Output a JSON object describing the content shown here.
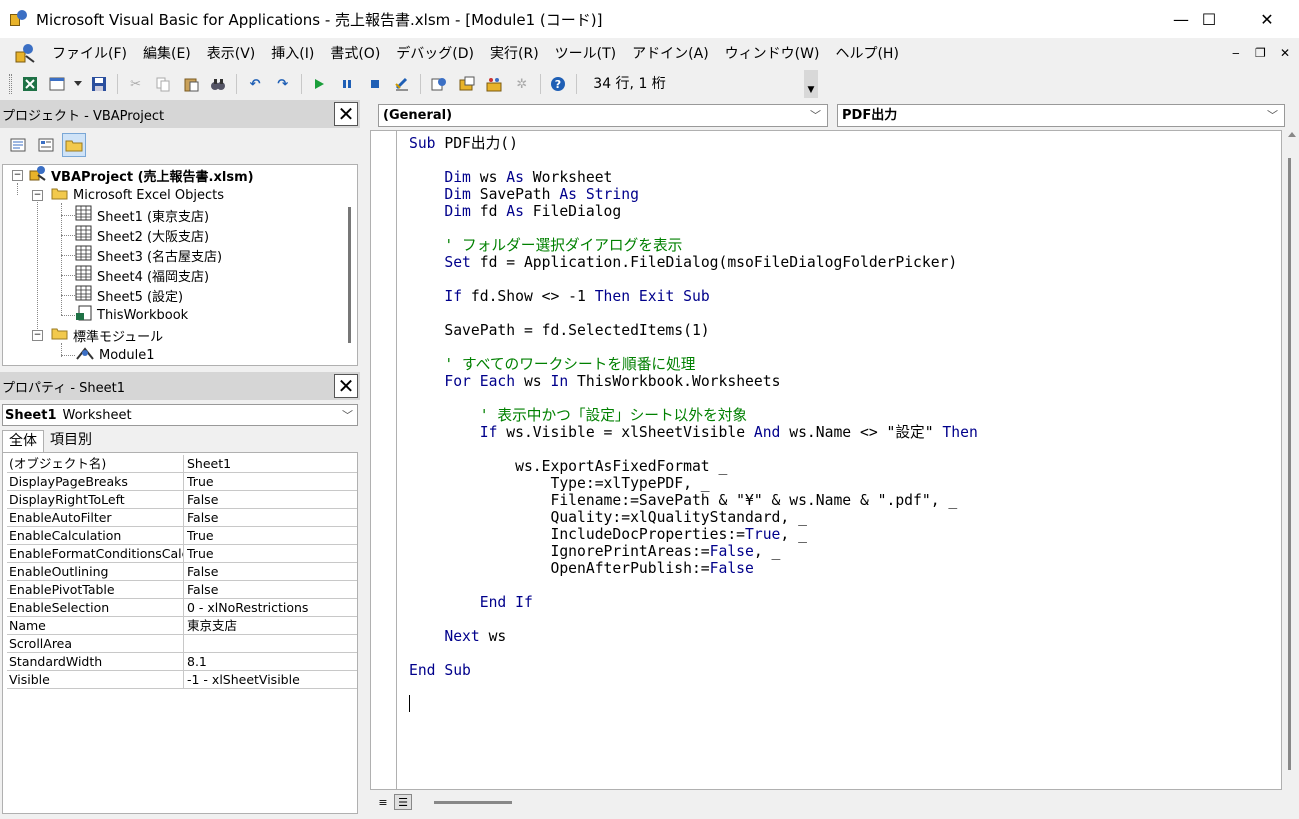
{
  "window": {
    "title": "Microsoft Visual Basic for Applications - 売上報告書.xlsm - [Module1 (コード)]",
    "minimize": "—",
    "maximize": "☐",
    "close": "✕"
  },
  "menu": {
    "items": [
      "ファイル(F)",
      "編集(E)",
      "表示(V)",
      "挿入(I)",
      "書式(O)",
      "デバッグ(D)",
      "実行(R)",
      "ツール(T)",
      "アドイン(A)",
      "ウィンドウ(W)",
      "ヘルプ(H)"
    ],
    "mdi_minimize": "‒",
    "mdi_restore": "❐",
    "mdi_close": "✕"
  },
  "toolbar": {
    "status": "34 行, 1 桁"
  },
  "project": {
    "title": "プロジェクト - VBAProject",
    "close": "✕",
    "tree": {
      "root": "VBAProject (売上報告書.xlsm)",
      "excel_objects": "Microsoft Excel Objects",
      "sheets": [
        "Sheet1 (東京支店)",
        "Sheet2 (大阪支店)",
        "Sheet3 (名古屋支店)",
        "Sheet4 (福岡支店)",
        "Sheet5 (設定)"
      ],
      "workbook": "ThisWorkbook",
      "modules_folder": "標準モジュール",
      "module": "Module1"
    }
  },
  "properties": {
    "title": "プロパティ - Sheet1",
    "close": "✕",
    "object_name": "Sheet1",
    "object_type": "Worksheet",
    "tabs": [
      "全体",
      "項目別"
    ],
    "rows": [
      {
        "k": "(オブジェクト名)",
        "v": "Sheet1"
      },
      {
        "k": "DisplayPageBreaks",
        "v": "True"
      },
      {
        "k": "DisplayRightToLeft",
        "v": "False"
      },
      {
        "k": "EnableAutoFilter",
        "v": "False"
      },
      {
        "k": "EnableCalculation",
        "v": "True"
      },
      {
        "k": "EnableFormatConditionsCalculation",
        "v": "True"
      },
      {
        "k": "EnableOutlining",
        "v": "False"
      },
      {
        "k": "EnablePivotTable",
        "v": "False"
      },
      {
        "k": "EnableSelection",
        "v": "0 - xlNoRestrictions"
      },
      {
        "k": "Name",
        "v": "東京支店"
      },
      {
        "k": "ScrollArea",
        "v": ""
      },
      {
        "k": "StandardWidth",
        "v": "8.1"
      },
      {
        "k": "Visible",
        "v": "-1 - xlSheetVisible"
      }
    ]
  },
  "code": {
    "object_combo": "(General)",
    "proc_combo": "PDF出力",
    "lines": [
      "Sub PDF出力()",
      "",
      "    Dim ws As Worksheet",
      "    Dim SavePath As String",
      "    Dim fd As FileDialog",
      "",
      "    ' フォルダー選択ダイアログを表示",
      "    Set fd = Application.FileDialog(msoFileDialogFolderPicker)",
      "",
      "    If fd.Show <> -1 Then Exit Sub",
      "",
      "    SavePath = fd.SelectedItems(1)",
      "",
      "    ' すべてのワークシートを順番に処理",
      "    For Each ws In ThisWorkbook.Worksheets",
      "",
      "        ' 表示中かつ「設定」シート以外を対象",
      "        If ws.Visible = xlSheetVisible And ws.Name <> \"設定\" Then",
      "",
      "            ws.ExportAsFixedFormat _",
      "                Type:=xlTypePDF, _",
      "                Filename:=SavePath & \"¥\" & ws.Name & \".pdf\", _",
      "                Quality:=xlQualityStandard, _",
      "                IncludeDocProperties:=True, _",
      "                IgnorePrintAreas:=False, _",
      "                OpenAfterPublish:=False",
      "",
      "        End If",
      "",
      "    Next ws",
      "",
      "End Sub",
      ""
    ]
  }
}
